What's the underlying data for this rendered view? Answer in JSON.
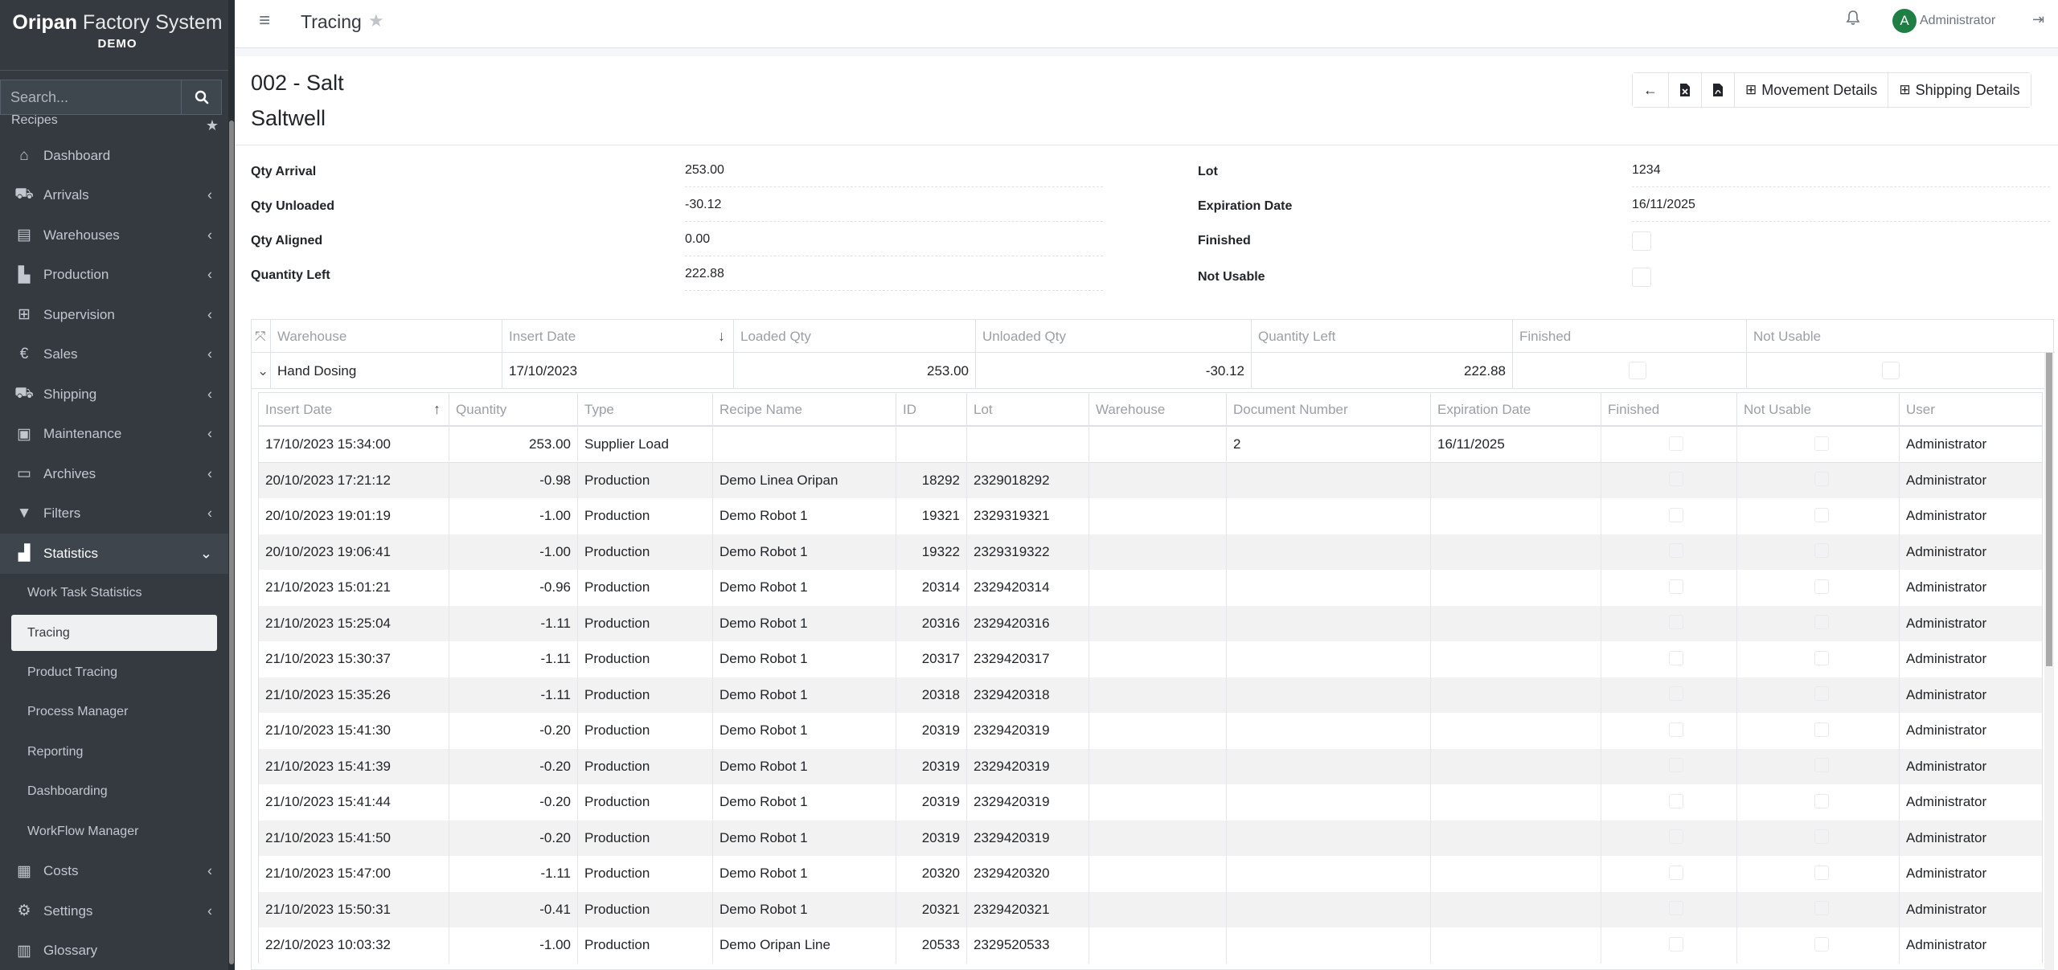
{
  "brand": {
    "name_bold": "Oripan",
    "name_light": " Factory System",
    "sub": "DEMO"
  },
  "search": {
    "placeholder": "Search..."
  },
  "sidebar": {
    "partial_item": "Recipes",
    "items": [
      {
        "label": "Dashboard",
        "icon": "home-icon"
      },
      {
        "label": "Arrivals",
        "icon": "truck-icon"
      },
      {
        "label": "Warehouses",
        "icon": "warehouse-icon"
      },
      {
        "label": "Production",
        "icon": "industry-icon"
      },
      {
        "label": "Supervision",
        "icon": "sitemap-icon"
      },
      {
        "label": "Sales",
        "icon": "euro-icon"
      },
      {
        "label": "Shipping",
        "icon": "truck-icon"
      },
      {
        "label": "Maintenance",
        "icon": "toolbox-icon"
      },
      {
        "label": "Archives",
        "icon": "folder-open-icon"
      },
      {
        "label": "Filters",
        "icon": "filter-icon"
      },
      {
        "label": "Statistics",
        "icon": "chart-area-icon"
      }
    ],
    "statistics_sub": [
      "Work Task Statistics",
      "Tracing",
      "Product Tracing",
      "Process Manager",
      "Reporting",
      "Dashboarding",
      "WorkFlow Manager"
    ],
    "bottom_items": [
      {
        "label": "Costs",
        "icon": "calculator-icon"
      },
      {
        "label": "Settings",
        "icon": "cogs-icon"
      },
      {
        "label": "Glossary",
        "icon": "book-icon"
      }
    ]
  },
  "topbar": {
    "title": "Tracing",
    "user": "Administrator",
    "avatar_letter": "A"
  },
  "item": {
    "code": "002 - Salt",
    "name": "Saltwell"
  },
  "toolbar": {
    "movement_label": "Movement Details",
    "shipping_label": "Shipping Details"
  },
  "fields_left": [
    {
      "label": "Qty Arrival",
      "value": "253.00"
    },
    {
      "label": "Qty Unloaded",
      "value": "-30.12"
    },
    {
      "label": "Qty Aligned",
      "value": "0.00"
    },
    {
      "label": "Quantity Left",
      "value": "222.88"
    }
  ],
  "fields_right": [
    {
      "label": "Lot",
      "value": "1234"
    },
    {
      "label": "Expiration Date",
      "value": "16/11/2025"
    },
    {
      "label": "Finished",
      "value": ""
    },
    {
      "label": "Not Usable",
      "value": ""
    }
  ],
  "outer_table": {
    "columns": [
      "Warehouse",
      "Insert Date",
      "Loaded Qty",
      "Unloaded Qty",
      "Quantity Left",
      "Finished",
      "Not Usable"
    ],
    "row": {
      "warehouse": "Hand Dosing",
      "insert_date": "17/10/2023",
      "loaded": "253.00",
      "unloaded": "-30.12",
      "left": "222.88"
    }
  },
  "inner_table": {
    "columns": [
      "Insert Date",
      "Quantity",
      "Type",
      "Recipe Name",
      "ID",
      "Lot",
      "Warehouse",
      "Document Number",
      "Expiration Date",
      "Finished",
      "Not Usable",
      "User"
    ],
    "rows": [
      [
        "17/10/2023 15:34:00",
        "253.00",
        "Supplier Load",
        "",
        "",
        "",
        "",
        "2",
        "16/11/2025",
        "Administrator"
      ],
      [
        "20/10/2023 17:21:12",
        "-0.98",
        "Production",
        "Demo Linea Oripan",
        "18292",
        "2329018292",
        "",
        "",
        "",
        "Administrator"
      ],
      [
        "20/10/2023 19:01:19",
        "-1.00",
        "Production",
        "Demo Robot 1",
        "19321",
        "2329319321",
        "",
        "",
        "",
        "Administrator"
      ],
      [
        "20/10/2023 19:06:41",
        "-1.00",
        "Production",
        "Demo Robot 1",
        "19322",
        "2329319322",
        "",
        "",
        "",
        "Administrator"
      ],
      [
        "21/10/2023 15:01:21",
        "-0.96",
        "Production",
        "Demo Robot 1",
        "20314",
        "2329420314",
        "",
        "",
        "",
        "Administrator"
      ],
      [
        "21/10/2023 15:25:04",
        "-1.11",
        "Production",
        "Demo Robot 1",
        "20316",
        "2329420316",
        "",
        "",
        "",
        "Administrator"
      ],
      [
        "21/10/2023 15:30:37",
        "-1.11",
        "Production",
        "Demo Robot 1",
        "20317",
        "2329420317",
        "",
        "",
        "",
        "Administrator"
      ],
      [
        "21/10/2023 15:35:26",
        "-1.11",
        "Production",
        "Demo Robot 1",
        "20318",
        "2329420318",
        "",
        "",
        "",
        "Administrator"
      ],
      [
        "21/10/2023 15:41:30",
        "-0.20",
        "Production",
        "Demo Robot 1",
        "20319",
        "2329420319",
        "",
        "",
        "",
        "Administrator"
      ],
      [
        "21/10/2023 15:41:39",
        "-0.20",
        "Production",
        "Demo Robot 1",
        "20319",
        "2329420319",
        "",
        "",
        "",
        "Administrator"
      ],
      [
        "21/10/2023 15:41:44",
        "-0.20",
        "Production",
        "Demo Robot 1",
        "20319",
        "2329420319",
        "",
        "",
        "",
        "Administrator"
      ],
      [
        "21/10/2023 15:41:50",
        "-0.20",
        "Production",
        "Demo Robot 1",
        "20319",
        "2329420319",
        "",
        "",
        "",
        "Administrator"
      ],
      [
        "21/10/2023 15:47:00",
        "-1.11",
        "Production",
        "Demo Robot 1",
        "20320",
        "2329420320",
        "",
        "",
        "",
        "Administrator"
      ],
      [
        "21/10/2023 15:50:31",
        "-0.41",
        "Production",
        "Demo Robot 1",
        "20321",
        "2329420321",
        "",
        "",
        "",
        "Administrator"
      ],
      [
        "22/10/2023 10:03:32",
        "-1.00",
        "Production",
        "Demo Oripan Line",
        "20533",
        "2329520533",
        "",
        "",
        "",
        "Administrator"
      ]
    ]
  }
}
